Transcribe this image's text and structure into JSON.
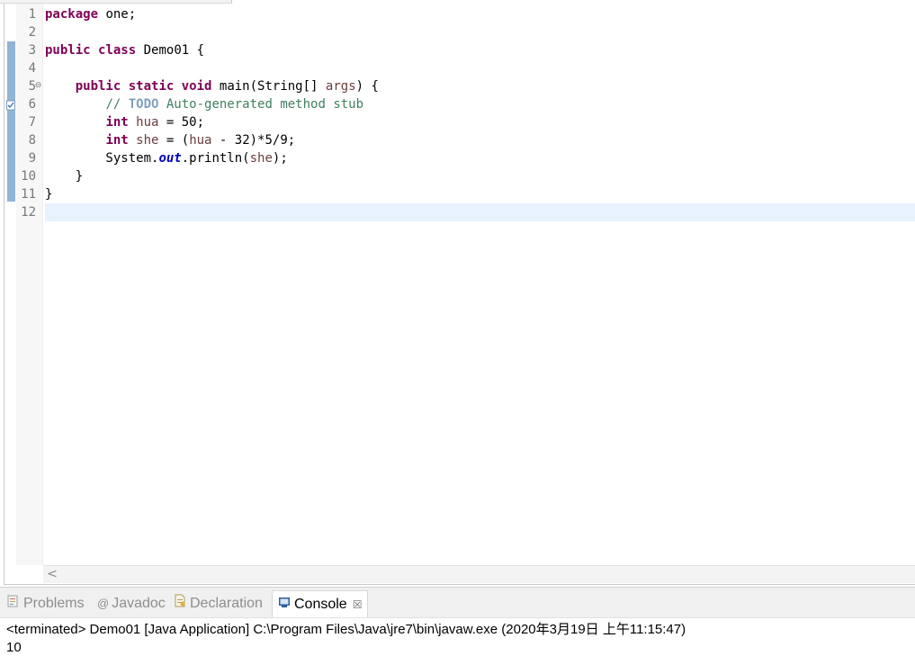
{
  "editor": {
    "lines": [
      {
        "number": "1",
        "tokens": [
          {
            "t": "package",
            "c": "kw"
          },
          {
            "t": " one;"
          }
        ]
      },
      {
        "number": "2",
        "tokens": []
      },
      {
        "number": "3",
        "tokens": [
          {
            "t": "public",
            "c": "kw"
          },
          {
            "t": " "
          },
          {
            "t": "class",
            "c": "kw"
          },
          {
            "t": " Demo01 {"
          }
        ]
      },
      {
        "number": "4",
        "tokens": []
      },
      {
        "number": "5",
        "tokens": [
          {
            "t": "    "
          },
          {
            "t": "public",
            "c": "kw"
          },
          {
            "t": " "
          },
          {
            "t": "static",
            "c": "kw"
          },
          {
            "t": " "
          },
          {
            "t": "void",
            "c": "kw"
          },
          {
            "t": " main(String[] "
          },
          {
            "t": "args",
            "c": "param"
          },
          {
            "t": ") {"
          }
        ]
      },
      {
        "number": "6",
        "tokens": [
          {
            "t": "        "
          },
          {
            "t": "// ",
            "c": "cm"
          },
          {
            "t": "TODO",
            "c": "todo"
          },
          {
            "t": " Auto-generated method stub",
            "c": "cm"
          }
        ]
      },
      {
        "number": "7",
        "tokens": [
          {
            "t": "        "
          },
          {
            "t": "int",
            "c": "kw"
          },
          {
            "t": " "
          },
          {
            "t": "hua",
            "c": "var"
          },
          {
            "t": " = 50;"
          }
        ]
      },
      {
        "number": "8",
        "tokens": [
          {
            "t": "        "
          },
          {
            "t": "int",
            "c": "kw"
          },
          {
            "t": " "
          },
          {
            "t": "she",
            "c": "var"
          },
          {
            "t": " = ("
          },
          {
            "t": "hua",
            "c": "var"
          },
          {
            "t": " - 32)*5/9;"
          }
        ]
      },
      {
        "number": "9",
        "tokens": [
          {
            "t": "        System."
          },
          {
            "t": "out",
            "c": "field"
          },
          {
            "t": ".println("
          },
          {
            "t": "she",
            "c": "var"
          },
          {
            "t": ");"
          }
        ]
      },
      {
        "number": "10",
        "tokens": [
          {
            "t": "    }"
          }
        ]
      },
      {
        "number": "11",
        "tokens": [
          {
            "t": "}"
          }
        ]
      },
      {
        "number": "12",
        "tokens": []
      }
    ],
    "current_line": 12,
    "fold_glyph": "⊖",
    "hscroll_left_glyph": "<"
  },
  "panel": {
    "tabs": [
      {
        "label": "Problems",
        "icon": "problems-icon",
        "active": false
      },
      {
        "label": "Javadoc",
        "icon": "at-icon",
        "active": false
      },
      {
        "label": "Declaration",
        "icon": "declaration-icon",
        "active": false
      },
      {
        "label": "Console",
        "icon": "console-icon",
        "active": true
      }
    ],
    "close_glyph": "☒",
    "at_glyph": "@",
    "console_status": "<terminated> Demo01 [Java Application] C:\\Program Files\\Java\\jre7\\bin\\javaw.exe (2020年3月19日 上午11:15:47)",
    "console_output": "10"
  },
  "colors": {
    "keyword": "#7f0055",
    "comment": "#3f7f5f",
    "todo": "#7f9fbf",
    "variable": "#6a3e3e",
    "field": "#0000c0",
    "current_line": "#e8f2fe",
    "ruler_marker": "#8fb4d6"
  }
}
